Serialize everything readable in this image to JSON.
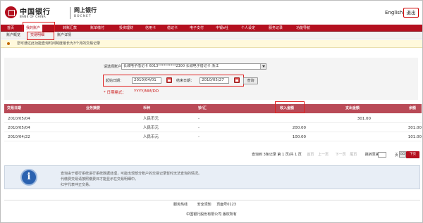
{
  "header": {
    "bank_cn": "中国银行",
    "bank_en": "BANK OF CHINA",
    "ebank_cn": "网上银行",
    "ebank_en": "BOCNET",
    "lang_label": "English",
    "logout_label": "退出",
    "brand_color": "#b4101f"
  },
  "nav": {
    "items": [
      "首页",
      "我的账户",
      "转账汇款",
      "账单缴付",
      "投资理财",
      "信用卡",
      "借记卡",
      "电子支付",
      "中银e社",
      "个人设定",
      "服务记录",
      "功能导航"
    ]
  },
  "subnav": {
    "items": [
      "账户概览",
      "交易明细",
      "账户详情"
    ]
  },
  "notice": {
    "text": "您可通过此功能查询时间跨度最长为3个月的交易记录"
  },
  "form": {
    "account_label": "请选择账户：",
    "account_value": "长城电子借记卡 6013**********2300 长城电子借记卡 浙江",
    "start_label": "起始日期：",
    "start_value": "2010/04/01",
    "end_label": "结束日期：",
    "end_value": "2010/05/27",
    "query_label": "查询",
    "format_label": "* 日期格式：",
    "format_value": "YYYY/MM/DD"
  },
  "table": {
    "headers": [
      "交易日期",
      "业务摘要",
      "币种",
      "钞/汇",
      "收入金额",
      "支出金额",
      "余额"
    ],
    "rows": [
      {
        "date": "2010/05/04",
        "summary": "",
        "currency": "人民币元",
        "cash": "-",
        "income": "",
        "expense": "301.00",
        "balance": ""
      },
      {
        "date": "2010/05/04",
        "summary": "",
        "currency": "人民币元",
        "cash": "-",
        "income": "200.00",
        "expense": "",
        "balance": "301.00"
      },
      {
        "date": "2010/04/22",
        "summary": "",
        "currency": "人民币元",
        "cash": "-",
        "income": "100.00",
        "expense": "",
        "balance": "101.00"
      }
    ]
  },
  "pager": {
    "summary": "查询到 3条记录  第 1 页/共 1 页",
    "first": "首页",
    "prev": "上一页",
    "next_link": "下一页",
    "last": "尾页",
    "jump": "跳转至第",
    "page_unit": "页",
    "go": "GO",
    "next_button": "下页"
  },
  "info": {
    "line1": "查询由于银行系统进行系统数据处理，可能出现部分账户的交易记录暂时无法查询的情况。",
    "line2": "代缴费交易请按照缴费日才能显示在交易明细中。",
    "line3": "红字代表冲正交易。"
  },
  "footer": {
    "link1": "服务热线",
    "link2": "安全须知",
    "page_no": "页面号0123",
    "copyright": "中国银行股份有限公司  版权所有"
  }
}
